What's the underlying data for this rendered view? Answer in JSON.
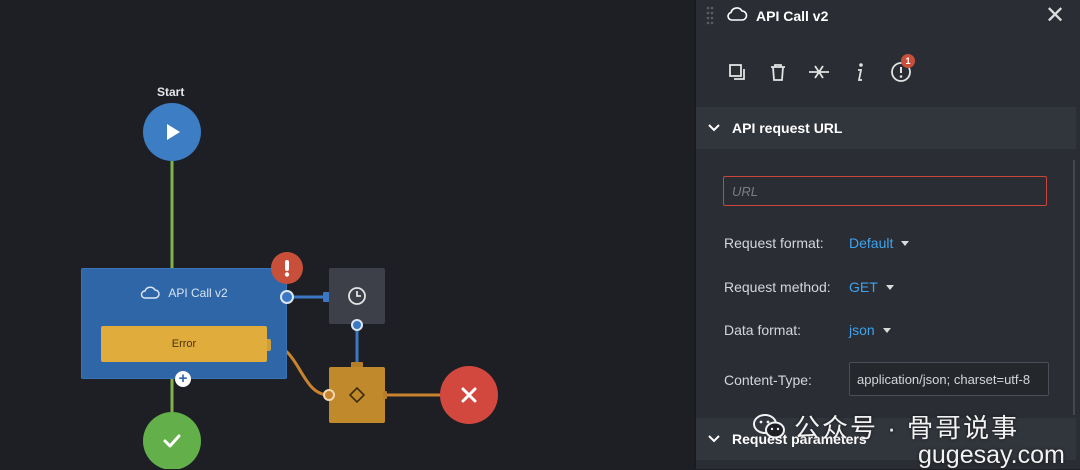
{
  "canvas": {
    "start_label": "Start",
    "api_node_title": "API Call v2",
    "error_port_label": "Error",
    "add_port_symbol": "+",
    "warning_symbol": "!"
  },
  "panel": {
    "title": "API Call v2",
    "close_symbol": "✕",
    "toolbar": {
      "icons": [
        "duplicate-icon",
        "delete-icon",
        "disconnect-icon",
        "info-icon",
        "warning-icon"
      ],
      "warning_count": "1"
    },
    "sections": {
      "url_title": "API request URL",
      "params_title": "Request parameters"
    },
    "url": {
      "value": "",
      "placeholder": "URL"
    },
    "fields": {
      "request_format_label": "Request format:",
      "request_format_value": "Default",
      "request_method_label": "Request method:",
      "request_method_value": "GET",
      "data_format_label": "Data format:",
      "data_format_value": "json",
      "content_type_label": "Content-Type:",
      "content_type_value": "application/json; charset=utf-8"
    }
  },
  "watermark": {
    "line1": "公众号 · 骨哥说事",
    "line2": "gugesay.com"
  },
  "colors": {
    "canvas_bg": "#1d1f25",
    "panel_bg": "#2a2d33",
    "start_node": "#3c7dc4",
    "success_node": "#63b04b",
    "fail_node": "#d2483e",
    "api_node": "#2f66a8",
    "error_port": "#e0ac3c",
    "condition_node": "#c08a2c",
    "timer_node": "#3d3f49",
    "link_accent": "#3fa3ef",
    "warning": "#c8503b"
  }
}
